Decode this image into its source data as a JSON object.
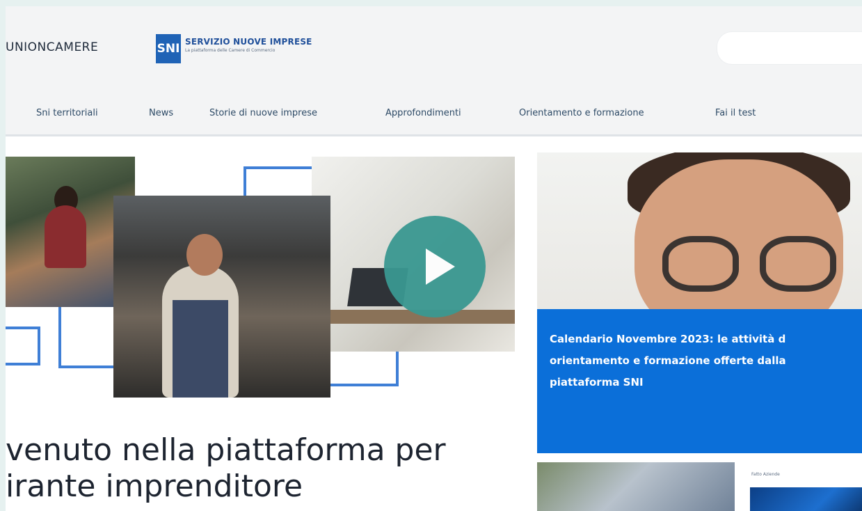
{
  "header": {
    "unioncamere_logo": "UNIONCAMERE",
    "sni_logo": {
      "badge": "SNI",
      "title": "SERVIZIO NUOVE IMPRESE",
      "subtitle": "La piattaforma delle Camere di Commercio"
    },
    "search": {
      "placeholder": ""
    }
  },
  "nav": {
    "items": [
      "Sni territoriali",
      "News",
      "Storie di nuove imprese",
      "Approfondimenti",
      "Orientamento e formazione",
      "Fai il test"
    ]
  },
  "hero": {
    "headline": "venuto nella piattaforma per\nirante imprenditore",
    "play_icon": "play-icon"
  },
  "featured": {
    "title": "Calendario Novembre 2023: le attività d\norientamento e formazione offerte dalla\npiattaforma SNI"
  },
  "thumbs": {
    "second_caption": "Fatto Aziende"
  },
  "colors": {
    "accent_blue": "#0b6fd9",
    "play_teal": "#3a9891",
    "frame_blue": "#3f7fd6"
  }
}
